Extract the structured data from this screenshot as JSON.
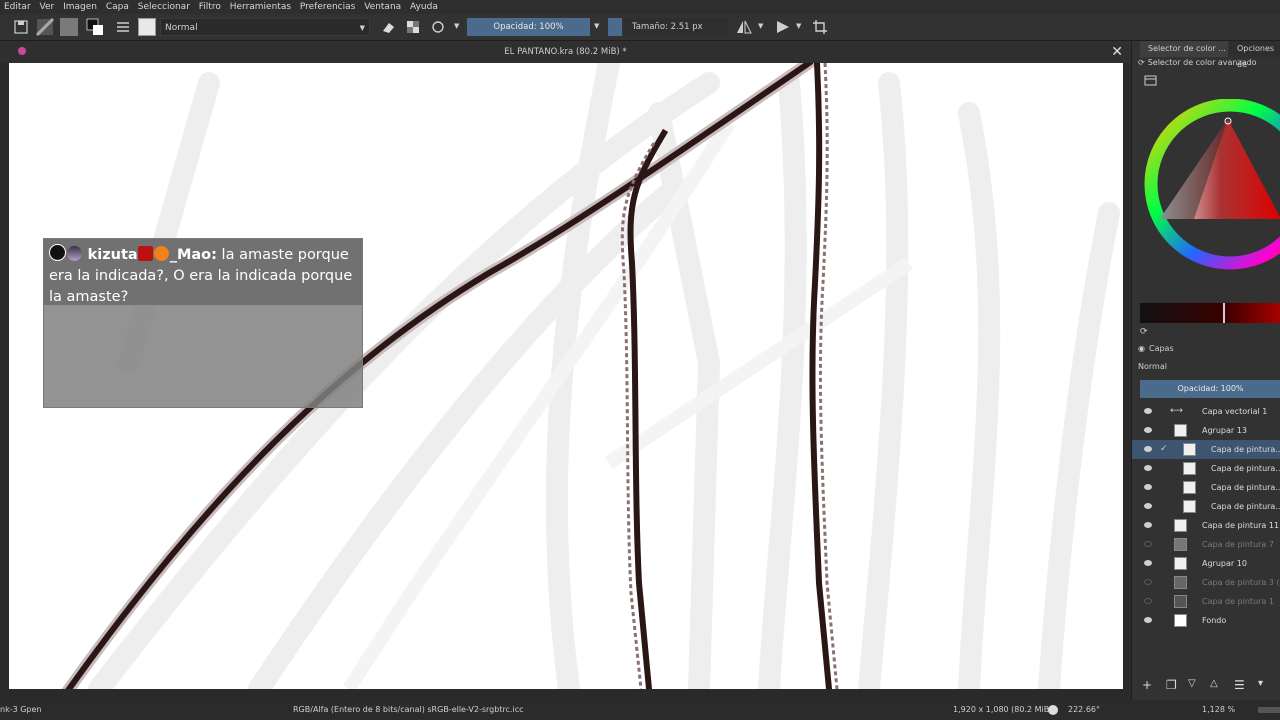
{
  "menu": [
    "Editar",
    "Ver",
    "Imagen",
    "Capa",
    "Seleccionar",
    "Filtro",
    "Herramientas",
    "Preferencias",
    "Ventana",
    "Ayuda"
  ],
  "toolbar": {
    "blend_mode": "Normal",
    "opacity_label": "Opacidad: 100%",
    "size_label": "Tamaño: 2.51 px"
  },
  "document": {
    "title": "EL PANTANO.kra (80.2 MiB) *"
  },
  "chat": {
    "username": "kizuta",
    "username_suffix": "_Mao:",
    "message": " la amaste porque era la indicada?, O era la indicada porque la amaste?"
  },
  "dock": {
    "tab_color_selector": "Selector de color ...",
    "tab_options": "Opciones de",
    "advanced_selector_label": "Selector de color avanzado",
    "layers_title": "Capas",
    "layer_blend": "Normal",
    "layer_opacity": "Opacidad:  100%",
    "layers": [
      {
        "name": "Capa vectorial 1",
        "visible": true,
        "active": false
      },
      {
        "name": "Agrupar 13",
        "visible": true,
        "active": false
      },
      {
        "name": "Capa de pintura...",
        "visible": true,
        "active": true
      },
      {
        "name": "Capa de pintura...",
        "visible": true,
        "active": false
      },
      {
        "name": "Capa de pintura...",
        "visible": true,
        "active": false
      },
      {
        "name": "Capa de pintura...",
        "visible": true,
        "active": false
      },
      {
        "name": "Capa de pintura 11",
        "visible": true,
        "active": false
      },
      {
        "name": "Capa de pintura 7",
        "visible": false,
        "active": false
      },
      {
        "name": "Agrupar 10",
        "visible": true,
        "active": false
      },
      {
        "name": "Capa de pintura 3 (...",
        "visible": false,
        "active": false
      },
      {
        "name": "Capa de pintura 1",
        "visible": false,
        "active": false
      },
      {
        "name": "Fondo",
        "visible": true,
        "active": false
      }
    ]
  },
  "status": {
    "brush": "nk-3 Gpen",
    "color_space": "RGB/Alfa (Entero de 8 bits/canal)  sRGB-elle-V2-srgbtrc.icc",
    "dimensions": "1,920 x 1,080 (80.2 MiB)",
    "rotation": "222.66°",
    "zoom": "1,128 %"
  },
  "colors": {
    "accent": "#4b6b8c",
    "canvas": "#ffffff",
    "stroke": "#2b1616"
  }
}
